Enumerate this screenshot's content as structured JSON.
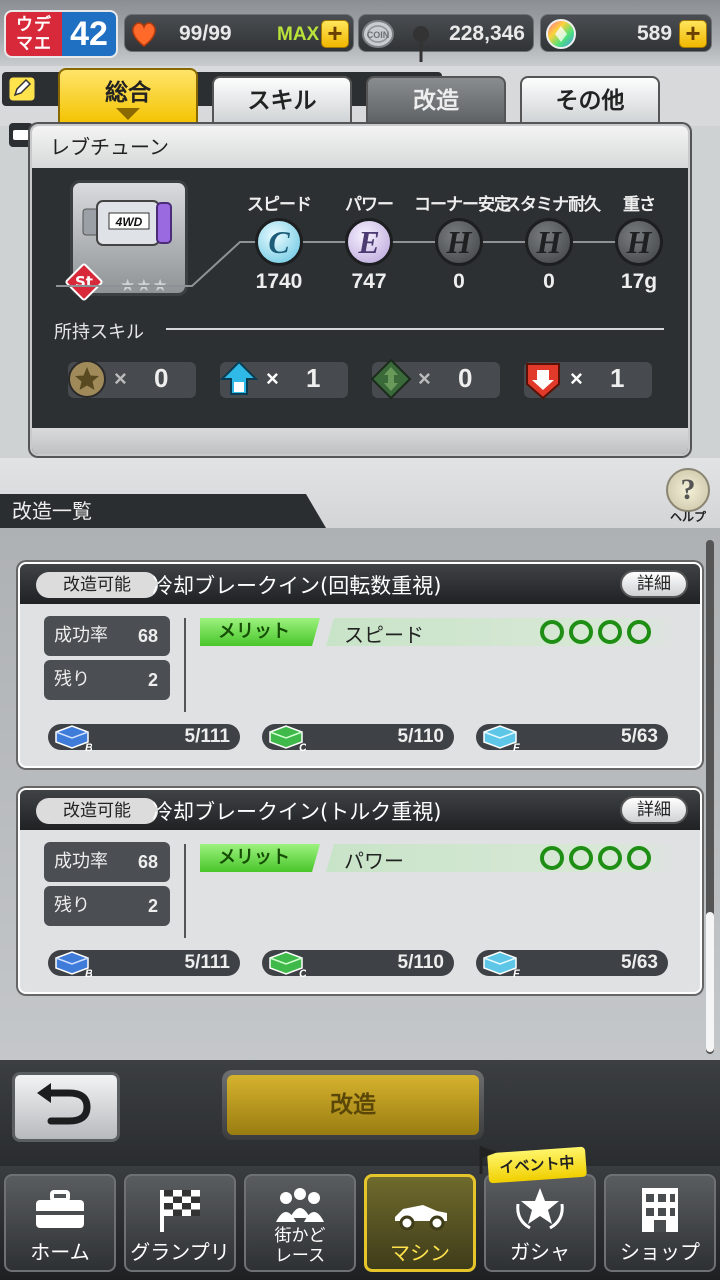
{
  "header": {
    "rank_label": "ウデ マエ",
    "rank_value": "42",
    "stamina": "99/99",
    "stamina_max": "MAX",
    "coins": "228,346",
    "gems": "589",
    "plus": "+"
  },
  "tabs": [
    "総合",
    "スキル",
    "改造",
    "その他"
  ],
  "part": {
    "name": "レブチューン",
    "grade_badge": "St",
    "stars": "★★★",
    "logo": "4WD"
  },
  "stats": [
    {
      "name": "スピード",
      "grade": "C",
      "value": "1740"
    },
    {
      "name": "パワー",
      "grade": "E",
      "value": "747"
    },
    {
      "name": "コーナー安定",
      "grade": "H",
      "value": "0"
    },
    {
      "name": "スタミナ耐久",
      "grade": "H",
      "value": "0"
    },
    {
      "name": "重さ",
      "grade": "H",
      "value": "17g"
    }
  ],
  "skills": {
    "title": "所持スキル",
    "times": "×",
    "items": [
      {
        "icon": "star-skill-icon",
        "count": "0"
      },
      {
        "icon": "up-arrow-skill-icon",
        "count": "1"
      },
      {
        "icon": "diamond-arrow-skill-icon",
        "count": "0"
      },
      {
        "icon": "down-arrow-skill-icon",
        "count": "1"
      }
    ]
  },
  "mod_list": {
    "title": "改造一覧",
    "help": "ヘルプ",
    "items": [
      {
        "status": "改造可能",
        "title": "冷却ブレークイン(回転数重視)",
        "detail": "詳細",
        "success_label": "成功率",
        "success_value": "68",
        "remaining_label": "残り",
        "remaining_value": "2",
        "merit_label": "メリット",
        "merit_stat": "スピード",
        "merit_level": 4,
        "materials": [
          {
            "grade": "B",
            "value": "5/111",
            "color": "#3f7bd9"
          },
          {
            "grade": "C",
            "value": "5/110",
            "color": "#3fb94a"
          },
          {
            "grade": "F",
            "value": "5/63",
            "color": "#5ec7e8"
          }
        ]
      },
      {
        "status": "改造可能",
        "title": "冷却ブレークイン(トルク重視)",
        "detail": "詳細",
        "success_label": "成功率",
        "success_value": "68",
        "remaining_label": "残り",
        "remaining_value": "2",
        "merit_label": "メリット",
        "merit_stat": "パワー",
        "merit_level": 4,
        "materials": [
          {
            "grade": "B",
            "value": "5/111",
            "color": "#3f7bd9"
          },
          {
            "grade": "C",
            "value": "5/110",
            "color": "#3fb94a"
          },
          {
            "grade": "F",
            "value": "5/63",
            "color": "#5ec7e8"
          }
        ]
      }
    ]
  },
  "actions": {
    "modify": "改造"
  },
  "nav": {
    "event_badge": "イベント中",
    "items": [
      "ホーム",
      "グランプリ",
      "街かど レース",
      "マシン",
      "ガシャ",
      "ショップ"
    ],
    "active": "マシン"
  },
  "colors": {
    "accent": "#f3c300",
    "merit_green": "#49c62a",
    "rank_red": "#d8293a",
    "rank_blue": "#1f6fc2"
  }
}
